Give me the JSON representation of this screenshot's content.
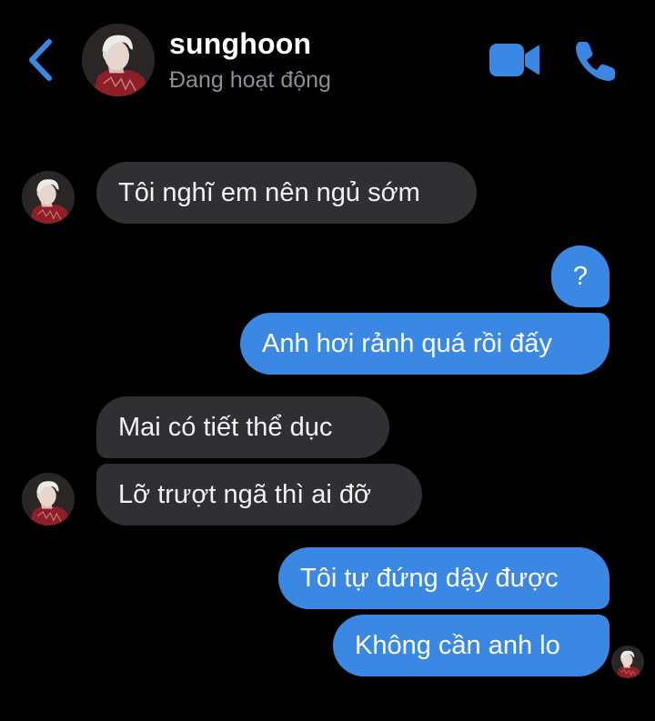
{
  "contact": {
    "name": "sunghoon",
    "status": "Đang hoạt động"
  },
  "icons": {
    "back": "chevron-left-icon",
    "video_call": "video-camera-icon",
    "voice_call": "phone-icon"
  },
  "colors": {
    "background": "#000000",
    "accent": "#3a88e3",
    "incoming_bubble": "#303033",
    "status_text": "#8e8e93"
  },
  "messages": [
    {
      "direction": "incoming",
      "text": "Tôi nghĩ em nên ngủ sớm"
    },
    {
      "direction": "outgoing",
      "text": "?"
    },
    {
      "direction": "outgoing",
      "text": "Anh hơi rảnh quá rồi đấy"
    },
    {
      "direction": "incoming",
      "text": "Mai có tiết thể dục"
    },
    {
      "direction": "incoming",
      "text": "Lỡ trượt ngã thì ai đỡ"
    },
    {
      "direction": "outgoing",
      "text": "Tôi tự đứng dậy được"
    },
    {
      "direction": "outgoing",
      "text": "Không cần anh lo"
    }
  ]
}
